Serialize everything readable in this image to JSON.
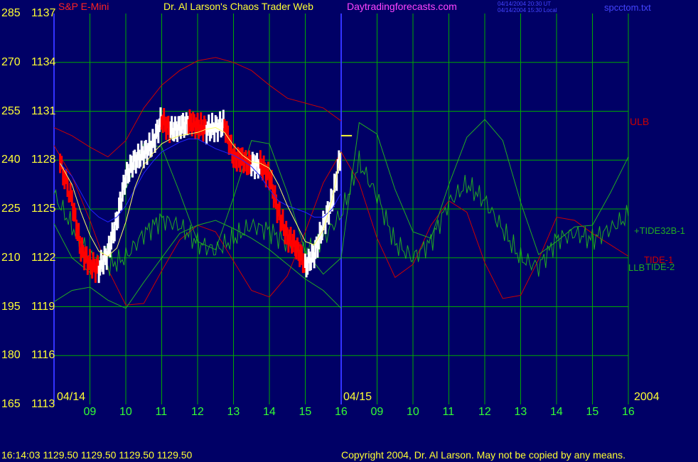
{
  "header": {
    "symbol": "S&P E-Mini",
    "title": "Dr. Al Larson's Chaos Trader Web",
    "site": "Daytradingforecasts.com",
    "ut_time": "04/14/2004 20:30 UT",
    "local_time": "04/14/2004 15:30 Local",
    "file": "spcctom.txt"
  },
  "footer": {
    "quote": "16:14:03  1129.50 1129.50 1129.50 1129.50",
    "copyright": "Copyright 2004, Dr. Al Larson. May not be copied by any means."
  },
  "colors": {
    "background": "#000066",
    "grid": "#00aa00",
    "price_up": "#ffffff",
    "price_down": "#ff0000",
    "divider": "#3333ff",
    "ulb": "#cc0000",
    "llb": "#22aa22",
    "tide1": "#cc0000",
    "tide2": "#22aa22",
    "tide32b": "#22aa22",
    "ma": "#2222ff",
    "axis_text": "#ffff33",
    "time_text": "#33ff33"
  },
  "chart_data": {
    "type": "line",
    "title": "S&P E-Mini",
    "y_left_ticks": [
      "285",
      "270",
      "255",
      "240",
      "225",
      "210",
      "195",
      "180",
      "165"
    ],
    "y_price_ticks": [
      "1137",
      "1134",
      "1131",
      "1128",
      "1125",
      "1122",
      "1119",
      "1116",
      "1113"
    ],
    "ylim": [
      1113,
      1137
    ],
    "x_tick_labels": [
      "09",
      "10",
      "11",
      "12",
      "13",
      "14",
      "15",
      "16",
      "09",
      "10",
      "11",
      "12",
      "13",
      "14",
      "15",
      "16"
    ],
    "date_labels": [
      "04/14",
      "04/15",
      "2004"
    ],
    "series_labels": {
      "ulb": "ULB",
      "tide32b": "+TIDE32B-1",
      "tide1": "TIDE-1",
      "llb": "LLB",
      "tide2": "TIDE-2"
    },
    "last_price": 1129.5,
    "price_x": [
      8.17,
      8.5,
      8.75,
      9.0,
      9.25,
      9.5,
      9.75,
      10.0,
      10.25,
      10.5,
      10.75,
      11.0,
      11.25,
      11.5,
      11.75,
      12.0,
      12.25,
      12.5,
      12.75,
      13.0,
      13.25,
      13.5,
      13.75,
      14.0,
      14.25,
      14.5,
      14.75,
      15.0,
      15.25,
      15.5,
      15.75,
      16.0
    ],
    "price_y": [
      1127.8,
      1125.5,
      1122.5,
      1121.6,
      1121.3,
      1122.3,
      1124.3,
      1127.0,
      1128.0,
      1128.4,
      1129.0,
      1130.5,
      1129.8,
      1130.0,
      1130.3,
      1130.1,
      1129.9,
      1130.0,
      1130.2,
      1128.2,
      1128.0,
      1127.7,
      1127.7,
      1127.0,
      1124.8,
      1123.3,
      1122.7,
      1121.5,
      1122.2,
      1124.0,
      1125.5,
      1128.6
    ],
    "ma_y": [
      1127.8,
      1126.5,
      1124.8,
      1123.4,
      1122.4,
      1122.1,
      1122.6,
      1124.2,
      1126.3,
      1127.7,
      1128.4,
      1129.0,
      1129.3,
      1129.5,
      1129.6,
      1129.7,
      1129.9,
      1130.0,
      1129.7,
      1128.9,
      1128.3,
      1127.9,
      1127.8,
      1127.5,
      1126.5,
      1125.2,
      1124.1,
      1123.0,
      1122.8,
      1123.7,
      1125.6,
      1128.5
    ],
    "blue_ma_y": [
      1127.8,
      1127.0,
      1126.0,
      1125.0,
      1124.5,
      1124.2,
      1124.5,
      1125.2,
      1126.2,
      1127.2,
      1127.9,
      1128.5,
      1128.8,
      1129.1,
      1129.3,
      1129.3,
      1129.0,
      1128.7,
      1128.5,
      1128.3,
      1128.0,
      1127.6,
      1127.0,
      1126.2,
      1125.5,
      1125.2,
      1125.0,
      1124.8,
      1124.5,
      1124.5,
      1125.0,
      1126.0
    ],
    "ulb_x": [
      8.0,
      8.5,
      9.0,
      9.5,
      10.0,
      10.5,
      11.0,
      11.5,
      12.0,
      12.5,
      13.0,
      13.5,
      14.0,
      14.5,
      15.0,
      15.5,
      16.0
    ],
    "ulb_y": [
      1130.0,
      1129.5,
      1128.8,
      1128.2,
      1129.2,
      1131.2,
      1132.6,
      1133.5,
      1134.1,
      1134.3,
      1134.0,
      1133.5,
      1132.6,
      1131.8,
      1131.5,
      1131.2,
      1130.4
    ],
    "llb_x": [
      8.0,
      8.5,
      9.0,
      9.5,
      10.0,
      10.5,
      11.0,
      11.5,
      12.0,
      12.5,
      13.0,
      13.5,
      14.0,
      14.5,
      15.0,
      15.5,
      16.0
    ],
    "llb_y": [
      1119.3,
      1120.0,
      1120.2,
      1119.4,
      1118.9,
      1120.5,
      1122.0,
      1123.5,
      1124.0,
      1124.3,
      1123.8,
      1123.2,
      1122.5,
      1121.6,
      1120.7,
      1120.0,
      1118.9
    ],
    "tide1_x": [
      8.0,
      8.5,
      9.0,
      9.5,
      10.0,
      10.5,
      11.0,
      11.5,
      12.0,
      12.5,
      13.0,
      13.5,
      14.0,
      14.5,
      15.0,
      15.5,
      16.0,
      16.5,
      17.0,
      17.5,
      18.0,
      18.5,
      19.0,
      19.5,
      20.0,
      20.5,
      21.0,
      21.5,
      22.0,
      22.5,
      23.0,
      23.5,
      24.0
    ],
    "tide1_y": [
      1128.9,
      1127.0,
      1124.3,
      1121.3,
      1119.1,
      1119.2,
      1121.2,
      1123.1,
      1124.0,
      1123.6,
      1121.8,
      1120.0,
      1119.6,
      1120.9,
      1123.6,
      1126.6,
      1128.5,
      1126.6,
      1123.2,
      1120.8,
      1121.6,
      1124.0,
      1125.5,
      1124.8,
      1121.7,
      1119.5,
      1119.7,
      1121.9,
      1124.5,
      1124.3,
      1123.5,
      1122.8,
      1122.1
    ],
    "tide2_x": [
      8.0,
      8.5,
      9.0,
      9.5,
      10.0,
      10.5,
      11.0,
      11.5,
      12.0,
      12.5,
      13.0,
      13.5,
      14.0,
      14.5,
      15.0,
      15.5,
      16.0,
      16.5,
      17.0,
      17.5,
      18.0,
      18.5,
      19.0,
      19.5,
      20.0,
      20.5,
      21.0,
      21.5,
      22.0,
      22.5,
      23.0,
      23.5,
      24.0
    ],
    "tide2_y": [
      1124.1,
      1122.0,
      1121.1,
      1122.8,
      1126.2,
      1129.0,
      1128.8,
      1126.0,
      1123.0,
      1122.5,
      1125.7,
      1129.2,
      1129.0,
      1126.0,
      1122.4,
      1121.0,
      1122.0,
      1130.3,
      1129.6,
      1126.2,
      1123.6,
      1123.2,
      1126.5,
      1129.4,
      1130.5,
      1129.2,
      1125.4,
      1122.2,
      1123.0,
      1123.9,
      1124.0,
      1126.0,
      1128.2
    ]
  }
}
